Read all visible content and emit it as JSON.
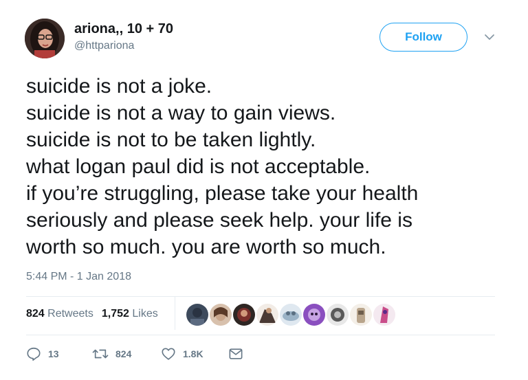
{
  "user": {
    "display_name": "ariona,, 10 + 70",
    "handle": "@httpariona"
  },
  "follow_button": {
    "label": "Follow",
    "color": "#1da1f2"
  },
  "tweet": {
    "lines": [
      "suicide is not a joke.",
      "suicide is not a way to gain views.",
      "suicide is not to be taken lightly.",
      "what logan paul did is not acceptable.",
      "if you’re struggling, please take your health",
      "seriously and please seek help. your life is",
      "worth so much. you are worth so much."
    ],
    "timestamp": "5:44 PM - 1 Jan 2018"
  },
  "stats": {
    "retweets_count": "824",
    "retweets_label": "Retweets",
    "likes_count": "1,752",
    "likes_label": "Likes"
  },
  "likers": {
    "avatar_count": 9,
    "colors": [
      "#3d4a5c",
      "#c9a58a",
      "#7a2f2b",
      "#4a3a34",
      "#9bb3c7",
      "#8a4fbf",
      "#5a5a5a",
      "#b9a58c",
      "#c94d8a"
    ]
  },
  "actions": {
    "reply_icon": "reply-icon",
    "reply_count": "13",
    "retweet_icon": "retweet-icon",
    "retweet_count": "824",
    "like_icon": "heart-icon",
    "like_count": "1.8K",
    "dm_icon": "envelope-icon"
  }
}
